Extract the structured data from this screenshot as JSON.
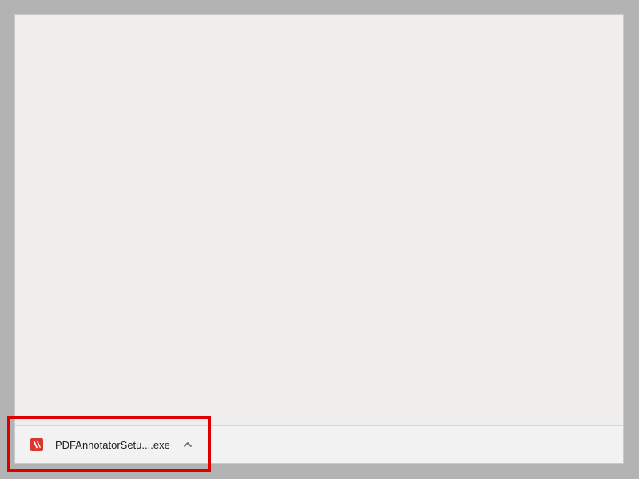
{
  "download": {
    "file_name": "PDFAnnotatorSetu....exe",
    "file_icon": "pdf-annotator-icon",
    "menu_icon": "chevron-up-icon"
  },
  "colors": {
    "page_background": "#b3b3b3",
    "window_background": "#efeeec",
    "shelf_background": "#f2f2f2",
    "highlight": "#dd0000",
    "app_icon": "#d9382e"
  }
}
